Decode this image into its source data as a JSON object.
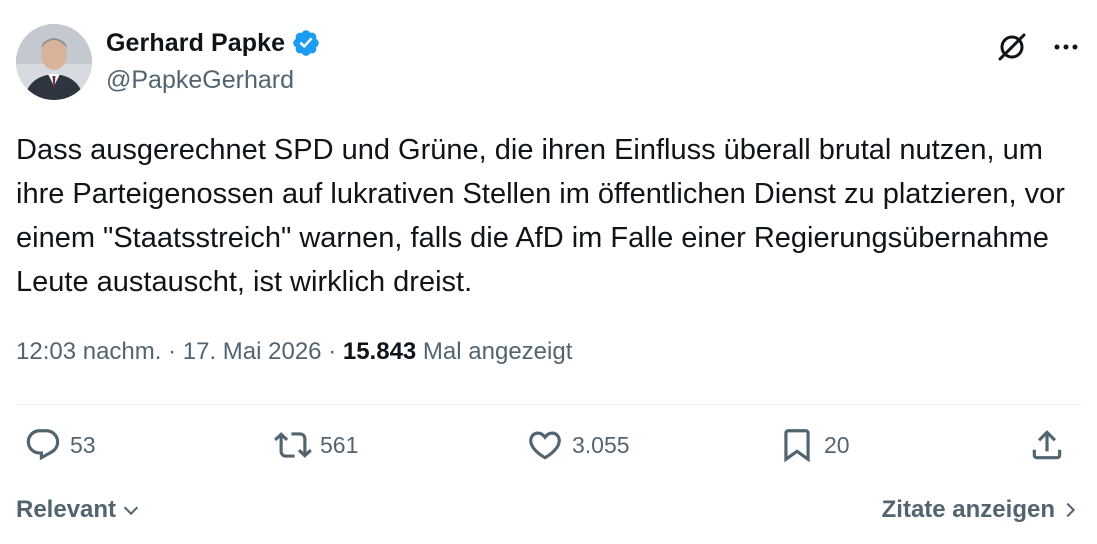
{
  "author": {
    "name": "Gerhard Papke",
    "handle": "@PapkeGerhard",
    "verified": true,
    "verified_color": "#1d9bf0"
  },
  "tweet": {
    "text": "Dass ausgerechnet SPD und Grüne, die ihren Einfluss überall brutal nutzen, um ihre Parteigenossen auf lukrativen Stellen im öffentlichen Dienst zu platzieren, vor einem \"Staatsstreich\" warnen, falls die AfD im Falle einer Regierungsübernahme Leute austauscht, ist wirklich dreist.",
    "time": "12:03 nachm.",
    "separator": " · ",
    "date": "17. Mai 2026",
    "views_count": "15.843",
    "views_label": " Mal angezeigt"
  },
  "actions": {
    "replies": "53",
    "reposts": "561",
    "likes": "3.055",
    "bookmarks": "20"
  },
  "footer": {
    "sort_label": "Relevant",
    "quotes_label": "Zitate anzeigen"
  },
  "icons": [
    "grok-icon",
    "more-icon",
    "verified-badge-icon",
    "reply-icon",
    "repost-icon",
    "like-icon",
    "bookmark-icon",
    "share-icon",
    "chevron-down-icon",
    "chevron-right-icon"
  ]
}
